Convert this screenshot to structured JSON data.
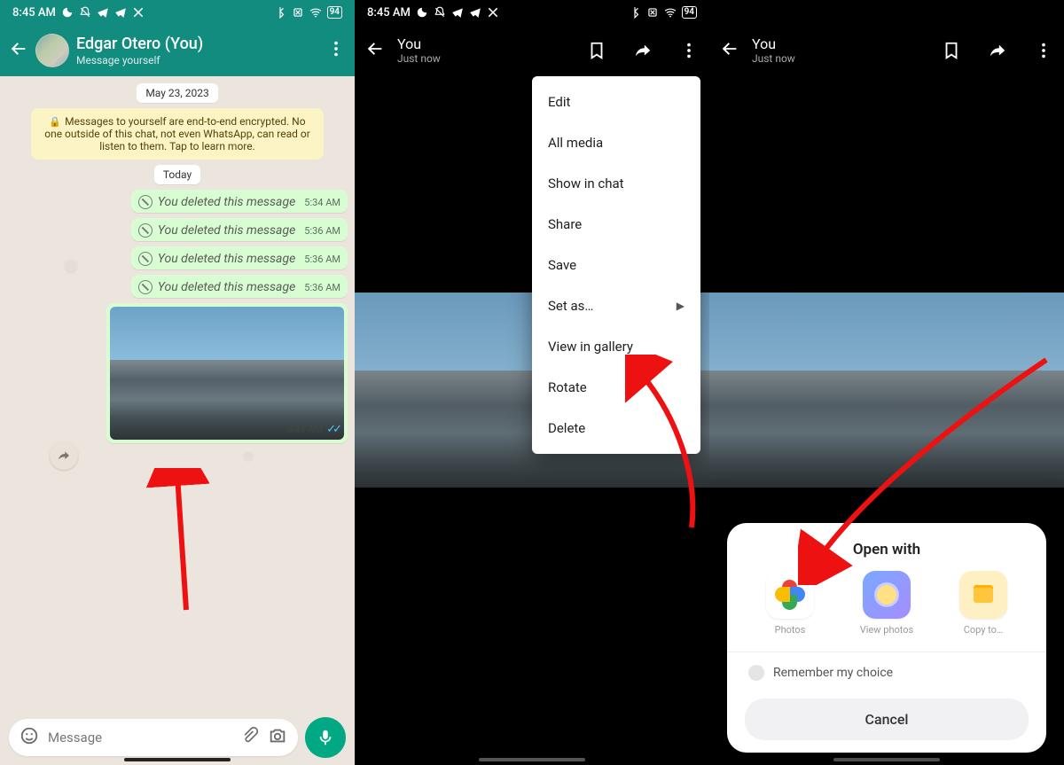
{
  "status": {
    "time": "8:45 AM",
    "battery": "94"
  },
  "panel1": {
    "chat_name": "Edgar Otero (You)",
    "chat_sub": "Message yourself",
    "date_pill": "May 23, 2023",
    "encryption_notice": "Messages to yourself are end-to-end encrypted. No one outside of this chat, not even WhatsApp, can read or listen to them. Tap to learn more.",
    "today_pill": "Today",
    "deleted_text": "You deleted this message",
    "deleted": [
      {
        "time": "5:34 AM"
      },
      {
        "time": "5:36 AM"
      },
      {
        "time": "5:36 AM"
      },
      {
        "time": "5:36 AM"
      }
    ],
    "image_time": "8:45 AM",
    "input_placeholder": "Message"
  },
  "panel2": {
    "title": "You",
    "sub": "Just now",
    "menu": {
      "edit": "Edit",
      "all_media": "All media",
      "show_in_chat": "Show in chat",
      "share": "Share",
      "save": "Save",
      "set_as": "Set as…",
      "view_in_gallery": "View in gallery",
      "rotate": "Rotate",
      "delete": "Delete"
    }
  },
  "panel3": {
    "title": "You",
    "sub": "Just now",
    "sheet": {
      "title": "Open with",
      "apps": {
        "photos": "Photos",
        "view_photos": "View photos",
        "copy_to": "Copy to…"
      },
      "remember": "Remember my choice",
      "cancel": "Cancel"
    }
  }
}
